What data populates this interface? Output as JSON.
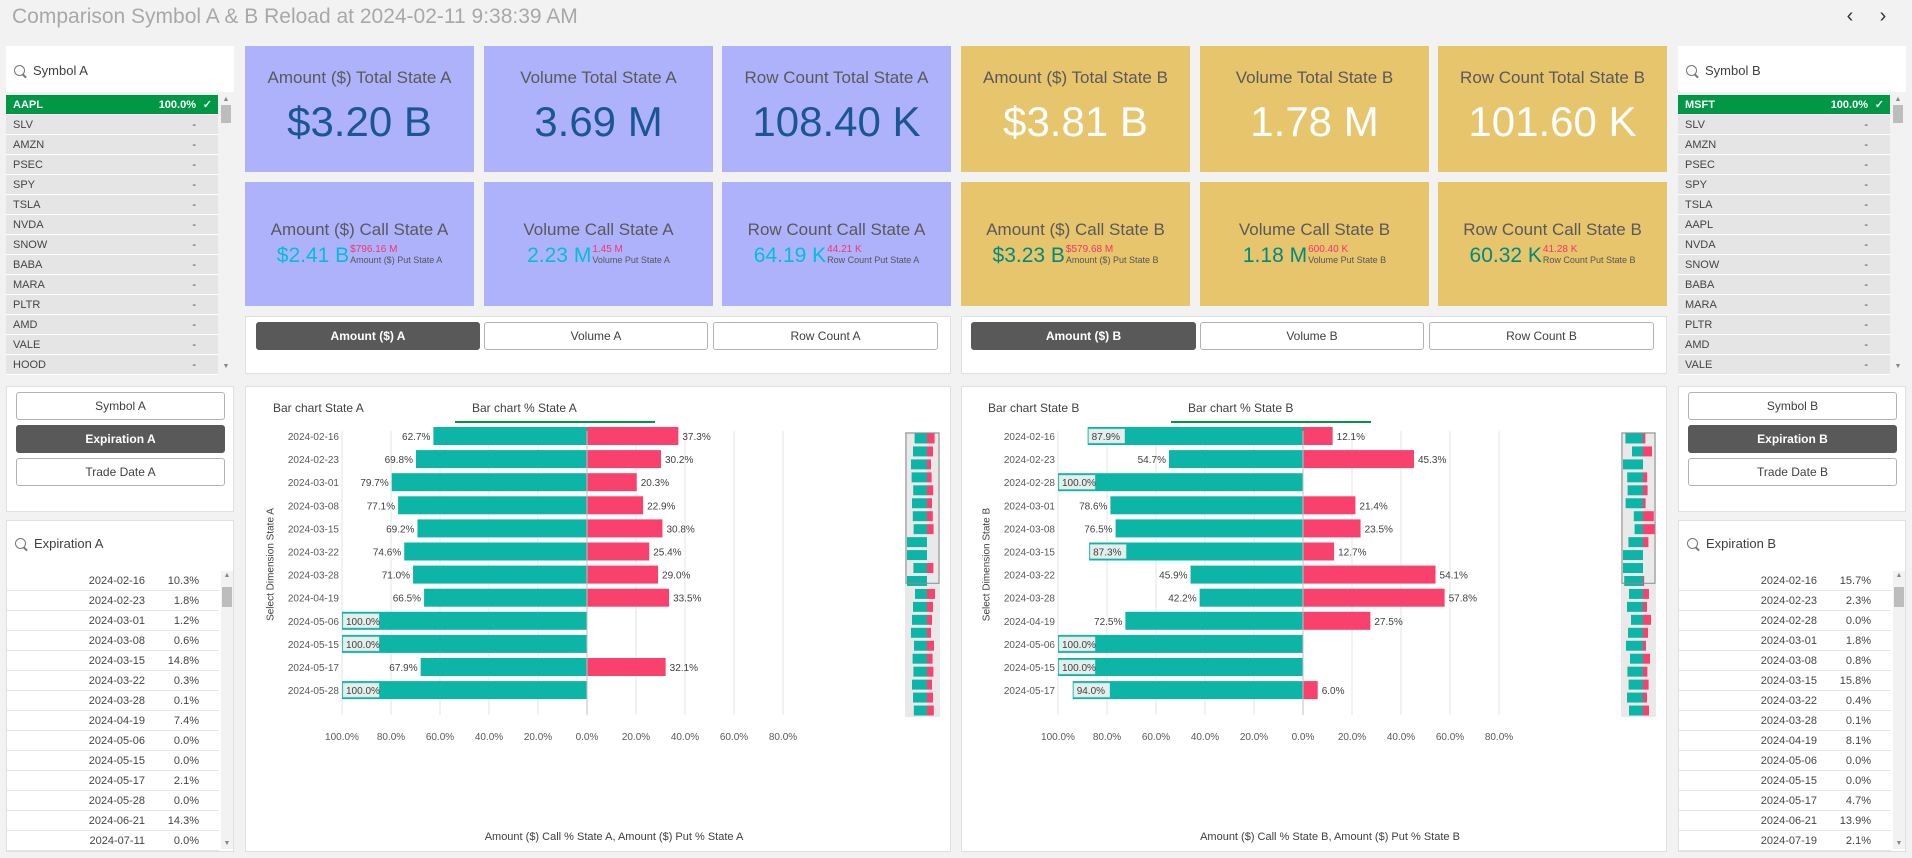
{
  "title": "Comparison Symbol A & B Reload at 2024-02-11 9:38:39 AM",
  "nav": {
    "prev": "‹",
    "next": "›"
  },
  "symbolA": {
    "header": "Symbol A",
    "items": [
      {
        "name": "AAPL",
        "value": "100.0%",
        "selected": true
      },
      {
        "name": "SLV",
        "value": "-"
      },
      {
        "name": "AMZN",
        "value": "-"
      },
      {
        "name": "PSEC",
        "value": "-"
      },
      {
        "name": "SPY",
        "value": "-"
      },
      {
        "name": "TSLA",
        "value": "-"
      },
      {
        "name": "NVDA",
        "value": "-"
      },
      {
        "name": "SNOW",
        "value": "-"
      },
      {
        "name": "BABA",
        "value": "-"
      },
      {
        "name": "MARA",
        "value": "-"
      },
      {
        "name": "PLTR",
        "value": "-"
      },
      {
        "name": "AMD",
        "value": "-"
      },
      {
        "name": "VALE",
        "value": "-"
      },
      {
        "name": "HOOD",
        "value": "-"
      }
    ]
  },
  "symbolB": {
    "header": "Symbol B",
    "items": [
      {
        "name": "MSFT",
        "value": "100.0%",
        "selected": true
      },
      {
        "name": "SLV",
        "value": "-"
      },
      {
        "name": "AMZN",
        "value": "-"
      },
      {
        "name": "PSEC",
        "value": "-"
      },
      {
        "name": "SPY",
        "value": "-"
      },
      {
        "name": "TSLA",
        "value": "-"
      },
      {
        "name": "AAPL",
        "value": "-"
      },
      {
        "name": "NVDA",
        "value": "-"
      },
      {
        "name": "SNOW",
        "value": "-"
      },
      {
        "name": "BABA",
        "value": "-"
      },
      {
        "name": "MARA",
        "value": "-"
      },
      {
        "name": "PLTR",
        "value": "-"
      },
      {
        "name": "AMD",
        "value": "-"
      },
      {
        "name": "VALE",
        "value": "-"
      }
    ]
  },
  "leftButtons": {
    "symbol": "Symbol A",
    "expiration": "Expiration A",
    "tradeDate": "Trade Date A"
  },
  "rightButtons": {
    "symbol": "Symbol B",
    "expiration": "Expiration B",
    "tradeDate": "Trade Date B"
  },
  "expirationA": {
    "header": "Expiration A",
    "rows": [
      [
        "2024-02-16",
        "10.3%"
      ],
      [
        "2024-02-23",
        "1.8%"
      ],
      [
        "2024-03-01",
        "1.2%"
      ],
      [
        "2024-03-08",
        "0.6%"
      ],
      [
        "2024-03-15",
        "14.8%"
      ],
      [
        "2024-03-22",
        "0.3%"
      ],
      [
        "2024-03-28",
        "0.1%"
      ],
      [
        "2024-04-19",
        "7.4%"
      ],
      [
        "2024-05-06",
        "0.0%"
      ],
      [
        "2024-05-15",
        "0.0%"
      ],
      [
        "2024-05-17",
        "2.1%"
      ],
      [
        "2024-05-28",
        "0.0%"
      ],
      [
        "2024-06-21",
        "14.3%"
      ],
      [
        "2024-07-11",
        "0.0%"
      ]
    ]
  },
  "expirationB": {
    "header": "Expiration B",
    "rows": [
      [
        "2024-02-16",
        "15.7%"
      ],
      [
        "2024-02-23",
        "2.3%"
      ],
      [
        "2024-02-28",
        "0.0%"
      ],
      [
        "2024-03-01",
        "1.8%"
      ],
      [
        "2024-03-08",
        "0.8%"
      ],
      [
        "2024-03-15",
        "15.8%"
      ],
      [
        "2024-03-22",
        "0.4%"
      ],
      [
        "2024-03-28",
        "0.1%"
      ],
      [
        "2024-04-19",
        "8.1%"
      ],
      [
        "2024-05-06",
        "0.0%"
      ],
      [
        "2024-05-15",
        "0.0%"
      ],
      [
        "2024-05-17",
        "4.7%"
      ],
      [
        "2024-06-21",
        "13.9%"
      ],
      [
        "2024-07-19",
        "2.1%"
      ]
    ]
  },
  "kpiA": {
    "amountTotal": {
      "title": "Amount ($) Total State A",
      "value": "$3.20 B"
    },
    "volumeTotal": {
      "title": "Volume Total State A",
      "value": "3.69 M"
    },
    "rowTotal": {
      "title": "Row Count Total State A",
      "value": "108.40 K"
    },
    "amountCall": {
      "title": "Amount ($) Call State A",
      "value": "$2.41 B",
      "put": "$796.16 M",
      "putLabel": "Amount ($) Put State A"
    },
    "volumeCall": {
      "title": "Volume Call State A",
      "value": "2.23 M",
      "put": "1.45 M",
      "putLabel": "Volume Put State A"
    },
    "rowCall": {
      "title": "Row Count Call State A",
      "value": "64.19 K",
      "put": "44.21 K",
      "putLabel": "Row Count Put State A"
    }
  },
  "kpiB": {
    "amountTotal": {
      "title": "Amount ($) Total State B",
      "value": "$3.81 B"
    },
    "volumeTotal": {
      "title": "Volume Total State B",
      "value": "1.78 M"
    },
    "rowTotal": {
      "title": "Row Count Total State B",
      "value": "101.60 K"
    },
    "amountCall": {
      "title": "Amount ($) Call State B",
      "value": "$3.23 B",
      "put": "$579.68 M",
      "putLabel": "Amount ($) Put State B"
    },
    "volumeCall": {
      "title": "Volume Call State B",
      "value": "1.18 M",
      "put": "600.40 K",
      "putLabel": "Volume Put State B"
    },
    "rowCall": {
      "title": "Row Count Call State B",
      "value": "60.32 K",
      "put": "41.28 K",
      "putLabel": "Row Count Put State B"
    }
  },
  "measureA": {
    "amount": "Amount ($) A",
    "volume": "Volume A",
    "rowCount": "Row Count A"
  },
  "measureB": {
    "amount": "Amount ($) B",
    "volume": "Volume B",
    "rowCount": "Row Count B"
  },
  "chartA": {
    "tab1": "Bar chart State A",
    "tab2": "Bar chart % State A",
    "ytitle": "Select Dimension State A",
    "xtitle": "Amount ($) Call % State A, Amount ($) Put % State A"
  },
  "chartB": {
    "tab1": "Bar chart State B",
    "tab2": "Bar chart % State B",
    "ytitle": "Select Dimension State B",
    "xtitle": "Amount ($) Call % State B, Amount ($) Put % State B"
  },
  "chart_data": [
    {
      "type": "bar",
      "title": "Bar chart % State A",
      "xlabel": "Amount ($) Call % State A, Amount ($) Put % State A",
      "ylabel": "Select Dimension State A",
      "orientation": "horizontal-diverging",
      "xlim": [
        -100,
        100
      ],
      "ticks": [
        "100.0%",
        "80.0%",
        "60.0%",
        "40.0%",
        "20.0%",
        "0.0%",
        "20.0%",
        "40.0%",
        "60.0%",
        "80.0%"
      ],
      "colors": {
        "call": "#0db5a6",
        "put": "#f8416d"
      },
      "categories": [
        "2024-02-16",
        "2024-02-23",
        "2024-03-01",
        "2024-03-08",
        "2024-03-15",
        "2024-03-22",
        "2024-03-28",
        "2024-04-19",
        "2024-05-06",
        "2024-05-15",
        "2024-05-17",
        "2024-05-28"
      ],
      "series": [
        {
          "values": [
            62.7,
            69.8,
            79.7,
            77.1,
            69.2,
            74.6,
            71.0,
            66.5,
            100.0,
            100.0,
            67.9,
            100.0
          ],
          "labels": [
            "62.7%",
            "69.8%",
            "79.7%",
            "77.1%",
            "69.2%",
            "74.6%",
            "71.0%",
            "66.5%",
            "100.0%",
            "100.0%",
            "67.9%",
            "100.0%"
          ]
        },
        {
          "values": [
            37.3,
            30.2,
            20.3,
            22.9,
            30.8,
            25.4,
            29.0,
            33.5,
            0,
            0,
            32.1,
            0
          ],
          "labels": [
            "37.3%",
            "30.2%",
            "20.3%",
            "22.9%",
            "30.8%",
            "25.4%",
            "29.0%",
            "33.5%",
            "",
            "",
            "32.1%",
            ""
          ]
        }
      ],
      "minimap": {
        "call": [
          62,
          70,
          80,
          77,
          69,
          75,
          71,
          67,
          100,
          100,
          68,
          100,
          60,
          70,
          75,
          80,
          65,
          72,
          68,
          75,
          70,
          66
        ],
        "put": [
          38,
          30,
          20,
          23,
          31,
          25,
          29,
          33,
          0,
          0,
          32,
          0,
          40,
          30,
          25,
          20,
          35,
          28,
          32,
          25,
          30,
          34
        ]
      }
    },
    {
      "type": "bar",
      "title": "Bar chart % State B",
      "xlabel": "Amount ($) Call % State B, Amount ($) Put % State B",
      "ylabel": "Select Dimension State B",
      "orientation": "horizontal-diverging",
      "xlim": [
        -100,
        100
      ],
      "ticks": [
        "100.0%",
        "80.0%",
        "60.0%",
        "40.0%",
        "20.0%",
        "0.0%",
        "20.0%",
        "40.0%",
        "60.0%",
        "80.0%"
      ],
      "colors": {
        "call": "#0db5a6",
        "put": "#f8416d"
      },
      "categories": [
        "2024-02-16",
        "2024-02-23",
        "2024-02-28",
        "2024-03-01",
        "2024-03-08",
        "2024-03-15",
        "2024-03-22",
        "2024-03-28",
        "2024-04-19",
        "2024-05-06",
        "2024-05-15",
        "2024-05-17"
      ],
      "series": [
        {
          "values": [
            87.9,
            54.7,
            100.0,
            78.6,
            76.5,
            87.3,
            45.9,
            42.2,
            72.5,
            100.0,
            100.0,
            94.0
          ],
          "labels": [
            "87.9%",
            "54.7%",
            "100.0%",
            "78.6%",
            "76.5%",
            "87.3%",
            "45.9%",
            "42.2%",
            "72.5%",
            "100.0%",
            "100.0%",
            "94.0%"
          ]
        },
        {
          "values": [
            12.1,
            45.3,
            0,
            21.4,
            23.5,
            12.7,
            54.1,
            57.8,
            27.5,
            0,
            0,
            6.0
          ],
          "labels": [
            "12.1%",
            "45.3%",
            "",
            "21.4%",
            "23.5%",
            "12.7%",
            "54.1%",
            "57.8%",
            "27.5%",
            "",
            "",
            "6.0%"
          ]
        }
      ],
      "minimap": {
        "call": [
          88,
          55,
          100,
          79,
          77,
          87,
          46,
          42,
          73,
          100,
          100,
          94,
          70,
          80,
          60,
          75,
          85,
          65,
          78,
          72,
          80,
          70
        ],
        "put": [
          12,
          45,
          0,
          21,
          23,
          13,
          54,
          58,
          27,
          0,
          0,
          6,
          30,
          20,
          40,
          25,
          15,
          35,
          22,
          28,
          20,
          30
        ]
      }
    }
  ]
}
